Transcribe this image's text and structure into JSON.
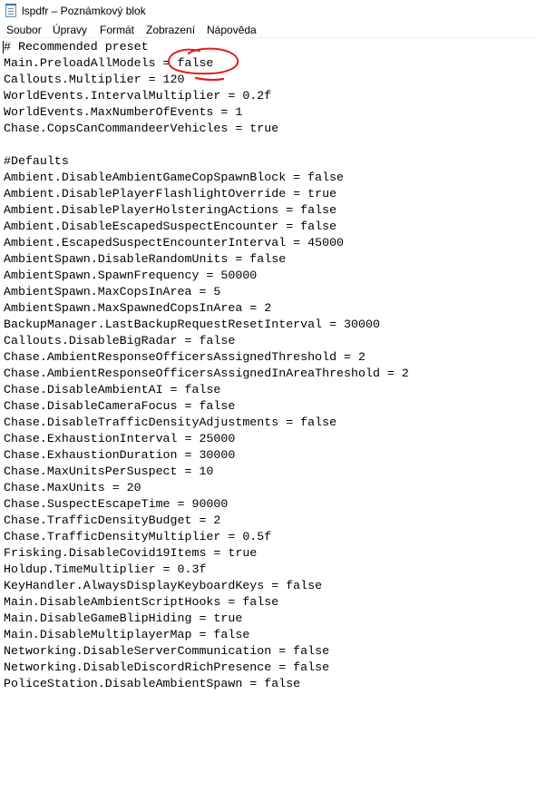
{
  "window": {
    "title": "lspdfr – Poznámkový blok"
  },
  "menu": {
    "items": [
      "Soubor",
      "Úpravy",
      "Formát",
      "Zobrazení",
      "Nápověda"
    ]
  },
  "colors": {
    "annotation_stroke": "#e0201c",
    "text": "#000000",
    "background": "#ffffff"
  },
  "annotation": {
    "shape": "hand-drawn red circle with underline",
    "marks": "false"
  },
  "editor": {
    "lines": [
      "# Recommended preset",
      "Main.PreloadAllModels = false",
      "Callouts.Multiplier = 120",
      "WorldEvents.IntervalMultiplier = 0.2f",
      "WorldEvents.MaxNumberOfEvents = 1",
      "Chase.CopsCanCommandeerVehicles = true",
      "",
      "#Defaults",
      "Ambient.DisableAmbientGameCopSpawnBlock = false",
      "Ambient.DisablePlayerFlashlightOverride = true",
      "Ambient.DisablePlayerHolsteringActions = false",
      "Ambient.DisableEscapedSuspectEncounter = false",
      "Ambient.EscapedSuspectEncounterInterval = 45000",
      "AmbientSpawn.DisableRandomUnits = false",
      "AmbientSpawn.SpawnFrequency = 50000",
      "AmbientSpawn.MaxCopsInArea = 5",
      "AmbientSpawn.MaxSpawnedCopsInArea = 2",
      "BackupManager.LastBackupRequestResetInterval = 30000",
      "Callouts.DisableBigRadar = false",
      "Chase.AmbientResponseOfficersAssignedThreshold = 2",
      "Chase.AmbientResponseOfficersAssignedInAreaThreshold = 2",
      "Chase.DisableAmbientAI = false",
      "Chase.DisableCameraFocus = false",
      "Chase.DisableTrafficDensityAdjustments = false",
      "Chase.ExhaustionInterval = 25000",
      "Chase.ExhaustionDuration = 30000",
      "Chase.MaxUnitsPerSuspect = 10",
      "Chase.MaxUnits = 20",
      "Chase.SuspectEscapeTime = 90000",
      "Chase.TrafficDensityBudget = 2",
      "Chase.TrafficDensityMultiplier = 0.5f",
      "Frisking.DisableCovid19Items = true",
      "Holdup.TimeMultiplier = 0.3f",
      "KeyHandler.AlwaysDisplayKeyboardKeys = false",
      "Main.DisableAmbientScriptHooks = false",
      "Main.DisableGameBlipHiding = true",
      "Main.DisableMultiplayerMap = false",
      "Networking.DisableServerCommunication = false",
      "Networking.DisableDiscordRichPresence = false",
      "PoliceStation.DisableAmbientSpawn = false"
    ]
  }
}
